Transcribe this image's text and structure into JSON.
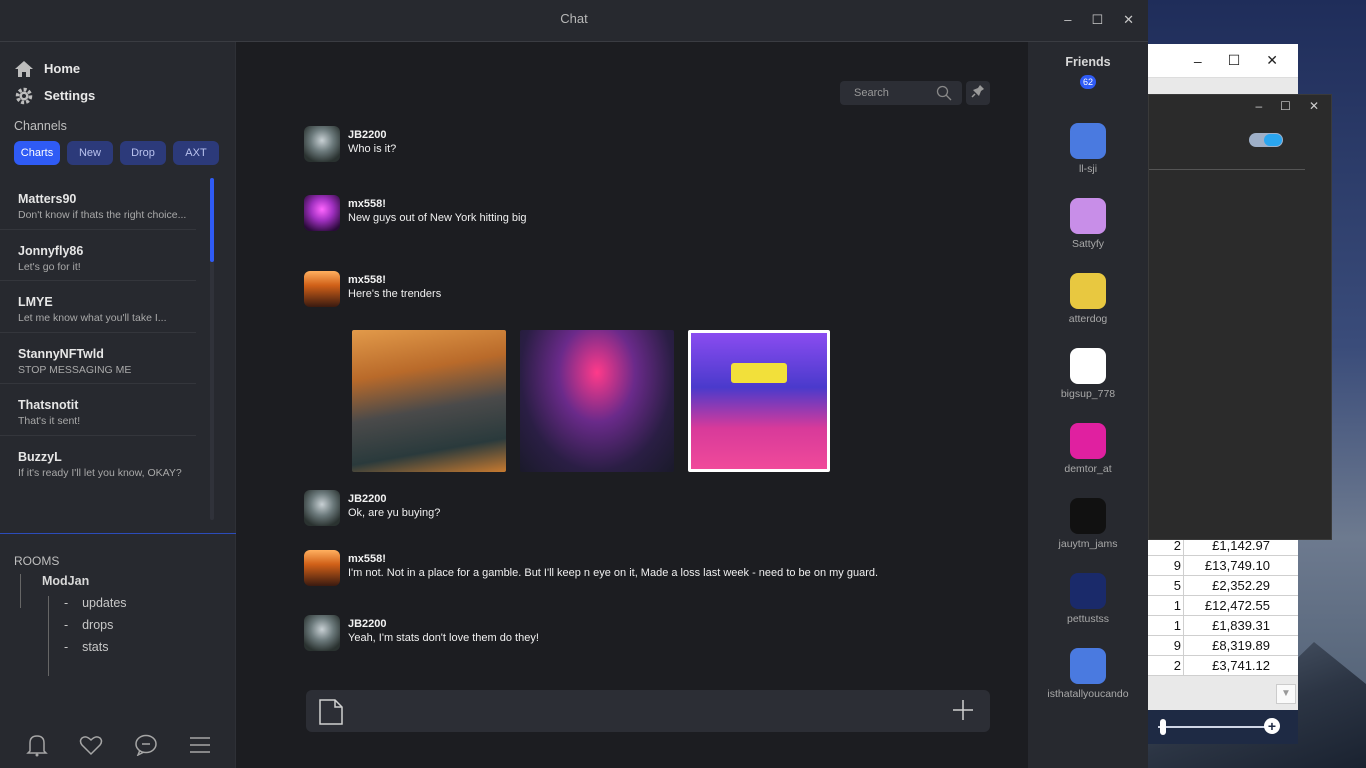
{
  "window": {
    "title": "Chat",
    "controls": [
      "–",
      "☐",
      "✕"
    ]
  },
  "nav": {
    "home": "Home",
    "settings": "Settings"
  },
  "channels": {
    "label": "Channels",
    "chips": [
      "Charts",
      "New",
      "Drop",
      "AXT"
    ],
    "active": "Charts"
  },
  "contacts": [
    {
      "name": "Matters90",
      "preview": "Don't know if thats the right choice..."
    },
    {
      "name": "Jonnyfly86",
      "preview": "Let's go for it!"
    },
    {
      "name": "LMYE",
      "preview": "Let me know what you'll take I..."
    },
    {
      "name": "StannyNFTwld",
      "preview": "STOP MESSAGING ME"
    },
    {
      "name": "Thatsnotit",
      "preview": "That's it sent!"
    },
    {
      "name": "BuzzyL",
      "preview": "If it's ready I'll let you know, OKAY?"
    }
  ],
  "rooms": {
    "label": "ROOMS",
    "root": "ModJan",
    "subs": [
      "updates",
      "drops",
      "stats"
    ],
    "bullet": "-"
  },
  "search": {
    "placeholder": "Search"
  },
  "messages": [
    {
      "user": "JB2200",
      "text": "Who is it?"
    },
    {
      "user": "mx558!",
      "text": "New guys out of New York hitting big"
    },
    {
      "user": "mx558!",
      "text": "Here's the trenders"
    },
    {
      "user": "JB2200",
      "text": "Ok, are yu buying?"
    },
    {
      "user": "mx558!",
      "text": "I'm not. Not in a place for a gamble.  But I'll keep n eye on it, Made a loss last week - need to be on my guard."
    },
    {
      "user": "JB2200",
      "text": "Yeah, I'm stats don't love them do they!"
    }
  ],
  "friends": {
    "label": "Friends",
    "count": "62",
    "list": [
      {
        "name": "ll-sji",
        "color": "#4a7ae0"
      },
      {
        "name": "Sattyfy",
        "color": "#c88ee8"
      },
      {
        "name": "atterdog",
        "color": "#e8c840"
      },
      {
        "name": "bigsup_778",
        "color": "#ffffff"
      },
      {
        "name": "demtor_at",
        "color": "#e020a0"
      },
      {
        "name": "jauytm_jams",
        "color": "#111111"
      },
      {
        "name": "pettustss",
        "color": "#1a2a6a"
      },
      {
        "name": "isthatallyoucando",
        "color": "#4a7ae0"
      }
    ]
  },
  "background_sheet": {
    "rows": [
      {
        "c1": "2",
        "c2": "£1,142.97"
      },
      {
        "c1": "9",
        "c2": "£13,749.10"
      },
      {
        "c1": "5",
        "c2": "£2,352.29"
      },
      {
        "c1": "1",
        "c2": "£12,472.55"
      },
      {
        "c1": "1",
        "c2": "£1,839.31"
      },
      {
        "c1": "9",
        "c2": "£8,319.89"
      },
      {
        "c1": "2",
        "c2": "£3,741.12"
      }
    ]
  },
  "colors": {
    "accent": "#2f5bf5",
    "window_bg": "#27292f",
    "chat_bg": "#1c1d21"
  }
}
